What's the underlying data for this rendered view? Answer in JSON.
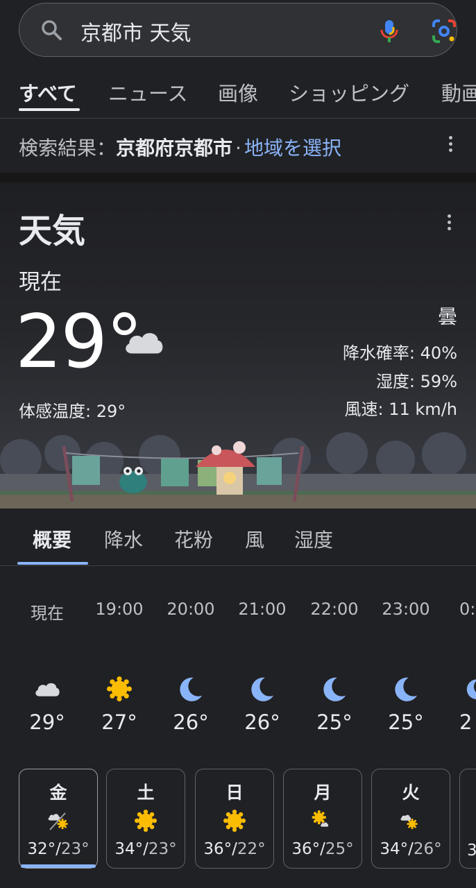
{
  "search": {
    "query": "京都市 天気",
    "icons": [
      "search-icon",
      "mic-icon",
      "lens-icon"
    ]
  },
  "tabs": [
    {
      "label": "すべて",
      "active": true
    },
    {
      "label": "ニュース"
    },
    {
      "label": "画像"
    },
    {
      "label": "ショッピング"
    },
    {
      "label": "動画"
    }
  ],
  "location": {
    "prefix": "検索結果：",
    "place": "京都府京都市",
    "dot": "·",
    "link": "地域を選択"
  },
  "weather": {
    "title": "天気",
    "now_label": "現在",
    "temp": "29°",
    "icon": "cloud-icon",
    "feels_like": "体感温度: 29°",
    "condition": "曇",
    "precip": "降水確率: 40%",
    "humidity": "湿度: 59%",
    "wind": "風速: 11 km/h"
  },
  "subtabs": [
    {
      "label": "概要",
      "active": true
    },
    {
      "label": "降水"
    },
    {
      "label": "花粉"
    },
    {
      "label": "風"
    },
    {
      "label": "湿度"
    }
  ],
  "hourly": [
    {
      "time": "現在",
      "icon": "cloud-icon",
      "temp": "29°"
    },
    {
      "time": "19:00",
      "icon": "sun-icon",
      "temp": "27°"
    },
    {
      "time": "20:00",
      "icon": "moon-icon",
      "temp": "26°"
    },
    {
      "time": "21:00",
      "icon": "moon-icon",
      "temp": "26°"
    },
    {
      "time": "22:00",
      "icon": "moon-icon",
      "temp": "25°"
    },
    {
      "time": "23:00",
      "icon": "moon-icon",
      "temp": "25°"
    },
    {
      "time": "0:",
      "icon": "moon-icon",
      "temp": "2"
    }
  ],
  "daily": [
    {
      "day": "金",
      "icon": "rain-sun-icon",
      "high": "32°",
      "low": "23°",
      "selected": true
    },
    {
      "day": "土",
      "icon": "sun-icon",
      "high": "34°",
      "low": "23°"
    },
    {
      "day": "日",
      "icon": "sun-icon",
      "high": "36°",
      "low": "22°"
    },
    {
      "day": "月",
      "icon": "sun-cloud-icon",
      "high": "36°",
      "low": "25°"
    },
    {
      "day": "火",
      "icon": "cloud-sun-icon",
      "high": "34°",
      "low": "26°"
    },
    {
      "day": "",
      "icon": "",
      "high": "3",
      "low": ""
    }
  ],
  "colors": {
    "background": "#202124",
    "accent": "#8ab4f8",
    "sun": "#fbbc04",
    "moon": "#8ab4f8"
  }
}
